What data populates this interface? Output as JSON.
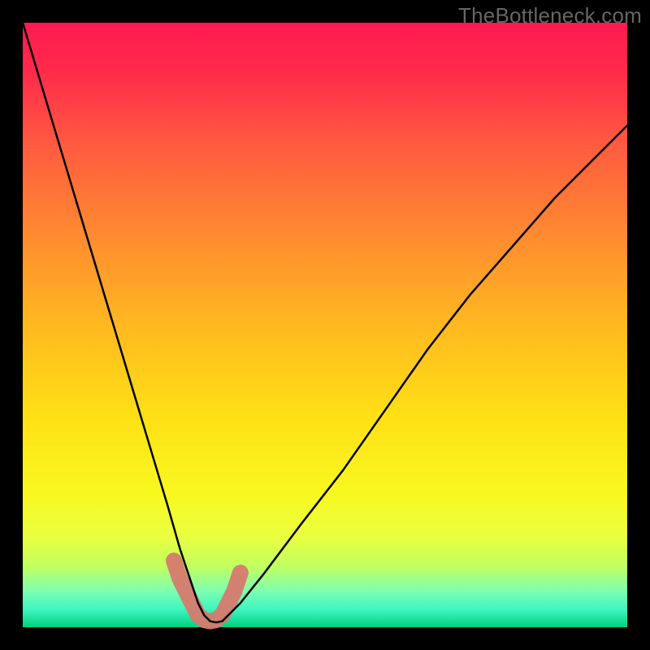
{
  "watermark": "TheBottleneck.com",
  "chart_data": {
    "type": "line",
    "title": "",
    "xlabel": "",
    "ylabel": "",
    "xlim": [
      0,
      100
    ],
    "ylim": [
      0,
      100
    ],
    "grid": false,
    "legend": false,
    "axes_visible": false,
    "background_gradient": {
      "stops": [
        {
          "offset": 0.0,
          "color": "#ff1a50"
        },
        {
          "offset": 0.08,
          "color": "#ff2a4b"
        },
        {
          "offset": 0.2,
          "color": "#ff5a40"
        },
        {
          "offset": 0.35,
          "color": "#ff8a30"
        },
        {
          "offset": 0.5,
          "color": "#ffb820"
        },
        {
          "offset": 0.65,
          "color": "#ffe015"
        },
        {
          "offset": 0.78,
          "color": "#f8f820"
        },
        {
          "offset": 0.85,
          "color": "#eaff40"
        },
        {
          "offset": 0.9,
          "color": "#c0ff60"
        },
        {
          "offset": 0.94,
          "color": "#7dffb0"
        },
        {
          "offset": 0.97,
          "color": "#40f5c0"
        },
        {
          "offset": 1.0,
          "color": "#00d080"
        }
      ]
    },
    "series": [
      {
        "name": "curve",
        "stroke": "#000000",
        "x": [
          0,
          3,
          6,
          9,
          12,
          15,
          18,
          21,
          24,
          26,
          28,
          29,
          30,
          31,
          32,
          33,
          34,
          36,
          40,
          46,
          53,
          60,
          67,
          74,
          81,
          88,
          95,
          100
        ],
        "values": [
          100,
          90,
          80,
          70,
          60,
          50,
          40,
          30,
          20,
          13,
          7,
          4,
          2,
          1,
          0.8,
          1,
          2,
          4,
          9,
          17,
          26,
          36,
          46,
          55,
          63,
          71,
          78,
          83
        ]
      },
      {
        "name": "highlight-band",
        "stroke": "#d67a6e",
        "type": "segment",
        "x": [
          25,
          26,
          27,
          28,
          29,
          30,
          31,
          32,
          33,
          34,
          35,
          36
        ],
        "values": [
          11,
          8,
          6,
          4,
          2,
          1.2,
          1,
          1.2,
          2,
          4,
          6,
          9
        ]
      }
    ],
    "annotations": []
  },
  "geometry": {
    "outer_size": 800,
    "inner_margin": 28,
    "inner_size": 744
  }
}
